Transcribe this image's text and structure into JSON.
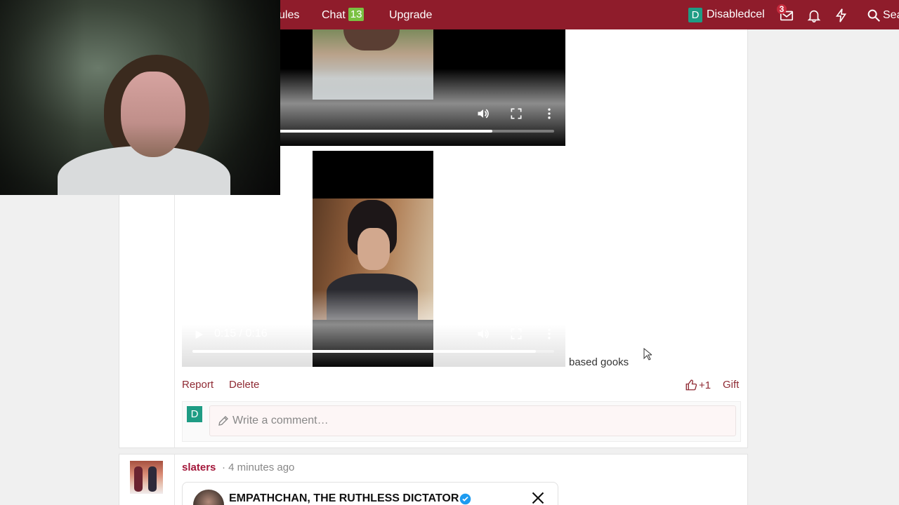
{
  "topbar": {
    "nav": [
      {
        "label": "ules"
      },
      {
        "label": "Chat",
        "badge": "13"
      },
      {
        "label": "Upgrade"
      }
    ],
    "user": {
      "avatar_letter": "D",
      "name": "Disabledcel"
    },
    "mail_count": "3",
    "search_label": "Sea"
  },
  "videos": [
    {
      "controls": [
        "volume-icon",
        "fullscreen-icon",
        "more-options-icon"
      ],
      "progress": 0.83
    },
    {
      "time": "0:15 / 0:16",
      "controls": [
        "play-icon",
        "volume-icon",
        "fullscreen-icon",
        "more-options-icon"
      ],
      "progress": 0.95
    }
  ],
  "post": {
    "text": "based gooks",
    "actions": {
      "report": "Report",
      "delete": "Delete",
      "like_count": "+1",
      "gift": "Gift"
    }
  },
  "comment": {
    "avatar_letter": "D",
    "placeholder": "Write a comment…"
  },
  "next_post": {
    "author": "slaters",
    "time": "· 4 minutes ago",
    "embed_name": "EMPATHCHAN, THE RUTHLESS DICTATOR"
  },
  "colors": {
    "brand": "#8f1c2b",
    "link": "#8f2a33",
    "author": "#a3173a",
    "chat_badge": "#7ac142",
    "avatar": "#1e9c84"
  }
}
